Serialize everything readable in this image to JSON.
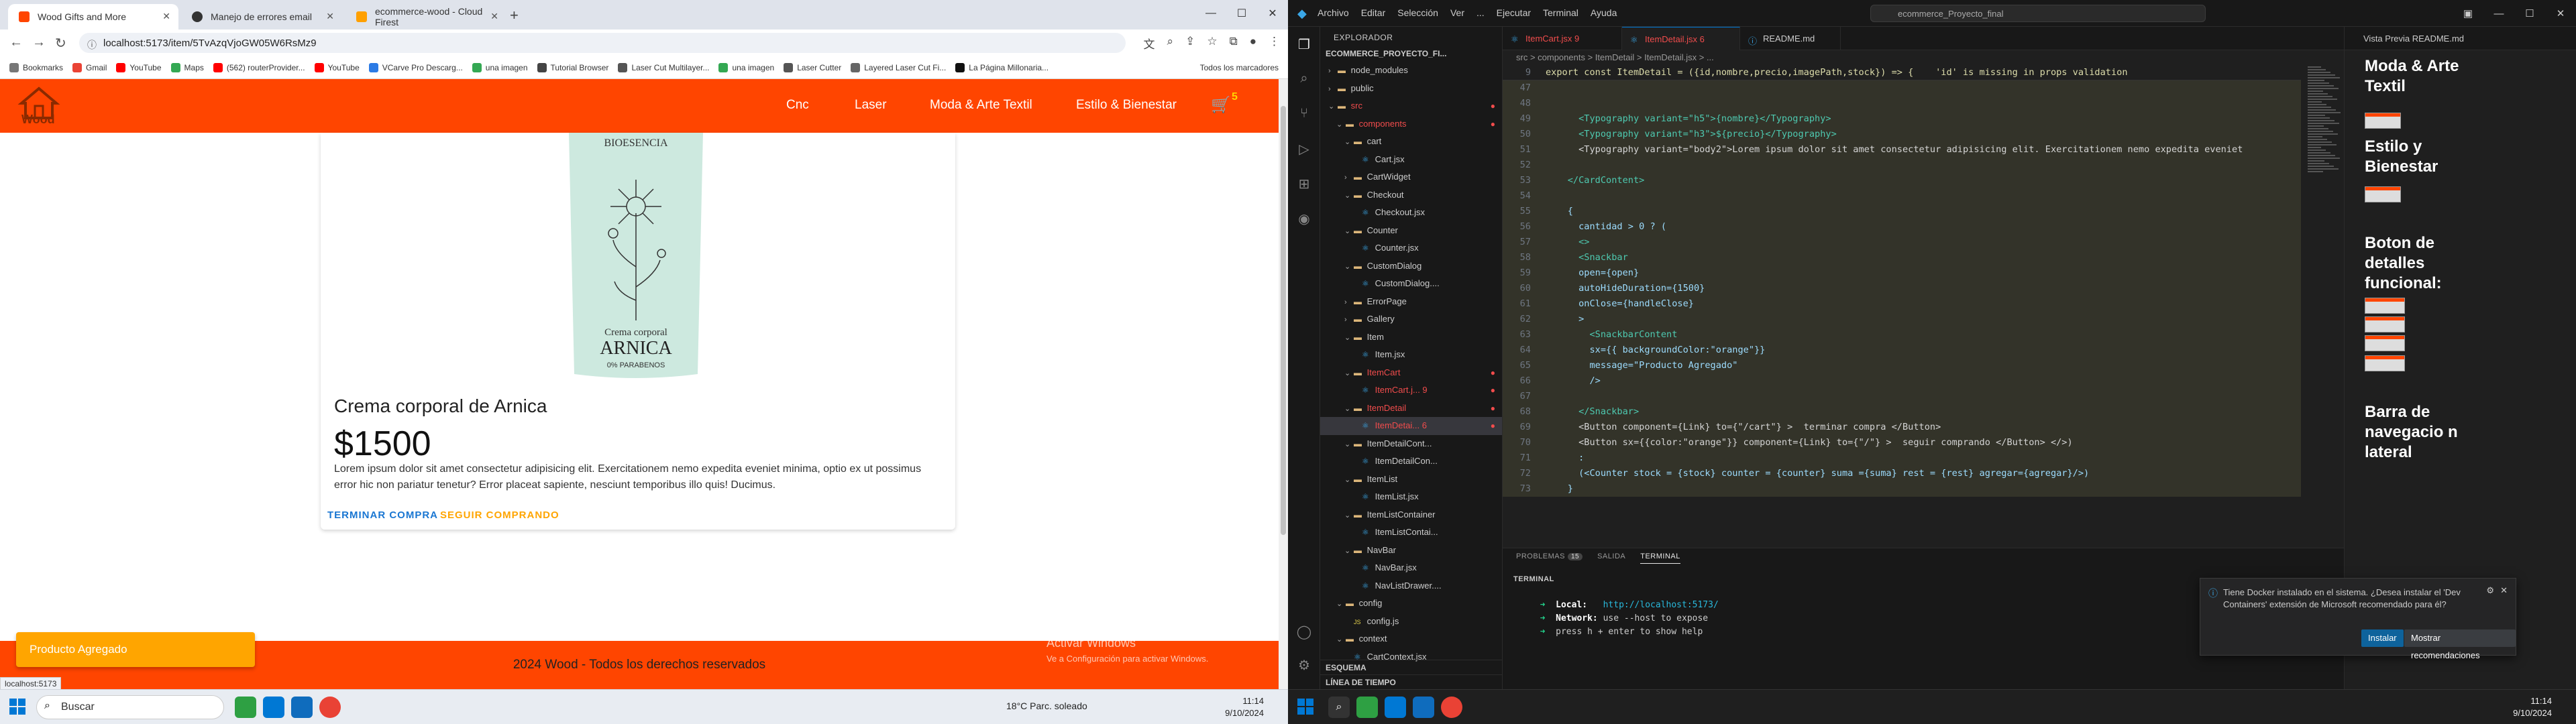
{
  "browser": {
    "tabs": [
      {
        "label": "Wood Gifts and More"
      },
      {
        "label": "Manejo de errores email"
      },
      {
        "label": "ecommerce-wood - Cloud Firest"
      }
    ],
    "url": "localhost:5173/item/5TvAzqVjoGW05W6RsMz9",
    "bookmarks": [
      "Bookmarks",
      "Gmail",
      "YouTube",
      "Maps",
      "(562) routerProvider...",
      "YouTube",
      "VCarve Pro Descarg...",
      "una imagen",
      "Tutorial Browser",
      "Laser Cut Multilayer...",
      "una imagen",
      "Laser Cutter",
      "Layered Laser Cut Fi...",
      "La Página Millonaria..."
    ],
    "all_bookmarks": "Todos los marcadores",
    "status_url": "localhost:5173"
  },
  "site": {
    "logo_text": "Wood",
    "nav": [
      "Cnc",
      "Laser",
      "Moda & Arte Textil",
      "Estilo & Bienestar"
    ],
    "cart_count": "5",
    "product": {
      "image_line1": "BIOESENCIA",
      "image_line2": "Crema corporal",
      "image_line3": "ARNICA",
      "image_line4": "0% PARABENOS",
      "name": "Crema corporal de Arnica",
      "price": "$1500",
      "description": "Lorem ipsum dolor sit amet consectetur adipisicing elit. Exercitationem nemo expedita eveniet minima, optio ex ut possimus error hic non pariatur tenetur? Error placeat sapiente, nesciunt temporibus illo quis! Ducimus.",
      "button_primary": "TERMINAR COMPRA",
      "button_secondary": "SEGUIR COMPRANDO"
    },
    "snackbar": "Producto Agregado",
    "footer": "2024 Wood - Todos los derechos reservados",
    "activate_title": "Activar Windows",
    "activate_sub": "Ve a Configuración para activar Windows.",
    "colors": {
      "brand": "#ff4500",
      "snackbar": "#ffa500",
      "primary_btn": "#1976d2",
      "secondary_btn": "#ffa500"
    }
  },
  "taskbar_left": {
    "search": "Buscar",
    "weather": "18°C  Parc. soleado",
    "time": "11:14",
    "date": "9/10/2024"
  },
  "vscode": {
    "menu": [
      "Archivo",
      "Editar",
      "Selección",
      "Ver",
      "...",
      "Ejecutar",
      "Terminal",
      "Ayuda"
    ],
    "search": "ecommerce_Proyecto_final",
    "explorer_title": "EXPLORADOR",
    "root": "ECOMMERCE_PROYECTO_FI...",
    "tree": [
      {
        "label": "node_modules",
        "icon": "folder",
        "depth": 1
      },
      {
        "label": "public",
        "icon": "folder",
        "depth": 1
      },
      {
        "label": "src",
        "icon": "folder",
        "depth": 1,
        "err": true
      },
      {
        "label": "components",
        "icon": "folder",
        "depth": 2,
        "err": true
      },
      {
        "label": "cart",
        "icon": "folder",
        "depth": 3
      },
      {
        "label": "Cart.jsx",
        "icon": "react",
        "depth": 4
      },
      {
        "label": "CartWidget",
        "icon": "folder",
        "depth": 3
      },
      {
        "label": "Checkout",
        "icon": "folder",
        "depth": 3
      },
      {
        "label": "Checkout.jsx",
        "icon": "react",
        "depth": 4
      },
      {
        "label": "Counter",
        "icon": "folder",
        "depth": 3
      },
      {
        "label": "Counter.jsx",
        "icon": "react",
        "depth": 4
      },
      {
        "label": "CustomDialog",
        "icon": "folder",
        "depth": 3
      },
      {
        "label": "CustomDialog....",
        "icon": "react",
        "depth": 4
      },
      {
        "label": "ErrorPage",
        "icon": "folder",
        "depth": 3
      },
      {
        "label": "Gallery",
        "icon": "folder",
        "depth": 3
      },
      {
        "label": "Item",
        "icon": "folder",
        "depth": 3
      },
      {
        "label": "Item.jsx",
        "icon": "react",
        "depth": 4
      },
      {
        "label": "ItemCart",
        "icon": "folder",
        "depth": 3,
        "err": true
      },
      {
        "label": "ItemCart.j...  9",
        "icon": "react",
        "depth": 4,
        "err": true
      },
      {
        "label": "ItemDetail",
        "icon": "folder",
        "depth": 3,
        "err": true
      },
      {
        "label": "ItemDetai...  6",
        "icon": "react",
        "depth": 4,
        "err": true,
        "sel": true
      },
      {
        "label": "ItemDetailCont...",
        "icon": "folder",
        "depth": 3
      },
      {
        "label": "ItemDetailCon...",
        "icon": "react",
        "depth": 4
      },
      {
        "label": "ItemList",
        "icon": "folder",
        "depth": 3
      },
      {
        "label": "ItemList.jsx",
        "icon": "react",
        "depth": 4
      },
      {
        "label": "ItemListContainer",
        "icon": "folder",
        "depth": 3
      },
      {
        "label": "ItemListContai...",
        "icon": "react",
        "depth": 4
      },
      {
        "label": "NavBar",
        "icon": "folder",
        "depth": 3
      },
      {
        "label": "NavBar.jsx",
        "icon": "react",
        "depth": 4
      },
      {
        "label": "NavListDrawer....",
        "icon": "react",
        "depth": 4
      },
      {
        "label": "config",
        "icon": "folder",
        "depth": 2
      },
      {
        "label": "config.js",
        "icon": "js",
        "depth": 3
      },
      {
        "label": "context",
        "icon": "folder",
        "depth": 2
      },
      {
        "label": "CartContext.jsx",
        "icon": "react",
        "depth": 3
      }
    ],
    "outline": "ESQUEMA",
    "timeline": "LÍNEA DE TIEMPO",
    "tabs": [
      "ItemCart.jsx  9",
      "ItemDetail.jsx  6",
      "README.md"
    ],
    "breadcrumb": "src  >  components  >  ItemDetail  >  ItemDetail.jsx  >  ...",
    "code": [
      {
        "n": "9",
        "t": "export const ItemDetail = ({id,nombre,precio,imagePath,stock}) => {    'id' is missing in props validation"
      },
      {
        "n": "47",
        "t": ""
      },
      {
        "n": "48",
        "t": ""
      },
      {
        "n": "49",
        "t": "      <Typography variant=\"h5\">{nombre}</Typography>"
      },
      {
        "n": "50",
        "t": "      <Typography variant=\"h3\">${precio}</Typography>"
      },
      {
        "n": "51",
        "t": "      <Typography variant=\"body2\">Lorem ipsum dolor sit amet consectetur adipisicing elit. Exercitationem nemo expedita eveniet"
      },
      {
        "n": "52",
        "t": ""
      },
      {
        "n": "53",
        "t": "    </CardContent>"
      },
      {
        "n": "54",
        "t": ""
      },
      {
        "n": "55",
        "t": "    {"
      },
      {
        "n": "56",
        "t": "      cantidad > 0 ? ("
      },
      {
        "n": "57",
        "t": "      <>"
      },
      {
        "n": "58",
        "t": "      <Snackbar"
      },
      {
        "n": "59",
        "t": "      open={open}"
      },
      {
        "n": "60",
        "t": "      autoHideDuration={1500}"
      },
      {
        "n": "61",
        "t": "      onClose={handleClose}"
      },
      {
        "n": "62",
        "t": "      >"
      },
      {
        "n": "63",
        "t": "        <SnackbarContent"
      },
      {
        "n": "64",
        "t": "        sx={{ backgroundColor:\"orange\"}}"
      },
      {
        "n": "65",
        "t": "        message=\"Producto Agregado\""
      },
      {
        "n": "66",
        "t": "        />"
      },
      {
        "n": "67",
        "t": ""
      },
      {
        "n": "68",
        "t": "      </Snackbar>"
      },
      {
        "n": "69",
        "t": "      <Button component={Link} to={\"/cart\"} >  terminar compra </Button>"
      },
      {
        "n": "70",
        "t": "      <Button sx={{color:\"orange\"}} component={Link} to={\"/\"} >  seguir comprando </Button> </>)"
      },
      {
        "n": "71",
        "t": "      :"
      },
      {
        "n": "72",
        "t": "      (<Counter stock = {stock} counter = {counter} suma ={suma} rest = {rest} agregar={agregar}/>)"
      },
      {
        "n": "73",
        "t": "    }"
      }
    ],
    "panel_tabs": [
      "PROBLEMAS",
      "SALIDA",
      "TERMINAL"
    ],
    "problems_count": "15",
    "terminal_title": "TERMINAL",
    "terminal_local_label": "Local:",
    "terminal_local_url": "http://localhost:5173/",
    "terminal_network_label": "Network:",
    "terminal_network_text": "use --host to expose",
    "terminal_help": "press h + enter to show help",
    "preview_tab": "Vista Previa README.md",
    "preview_headings": [
      "Moda & Arte Textil",
      "Estilo y Bienestar",
      "Boton de detalles funcional:",
      "Barra de navegacio n lateral"
    ],
    "notification": "Tiene Docker instalado en el sistema. ¿Desea instalar el 'Dev Containers' extensión de Microsoft recomendado para él?",
    "notif_install": "Instalar",
    "notif_show": "Mostrar recomendaciones"
  },
  "taskbar_right": {
    "time": "11:14",
    "date": "9/10/2024"
  }
}
